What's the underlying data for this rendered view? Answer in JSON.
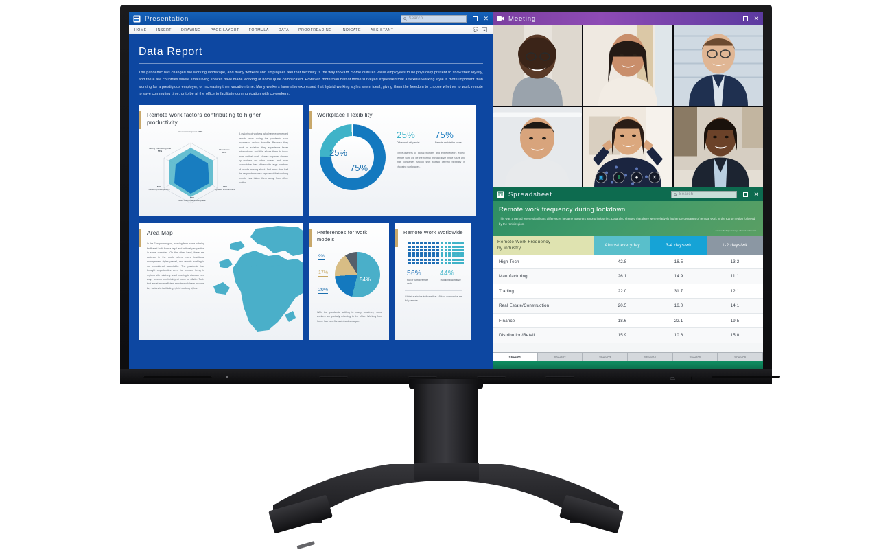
{
  "presentation": {
    "title": "Presentation",
    "icon": "presentation-icon",
    "search_placeholder": "Search",
    "ribbon_tabs": [
      "HOME",
      "INSERT",
      "DRAWING",
      "PAGE LAYOUT",
      "FORMULA",
      "DATA",
      "PROOFREADING",
      "INDICATE",
      "ASSISTANT"
    ],
    "slide_title": "Data Report",
    "slide_body": "The pandemic has changed the working landscape, and many workers and employees feel that flexibility is the way forward. Some cultures value employees to be physically present to show their loyalty, and there are countries where small living spaces have made working at home quite complicated. However, more than half of those surveyed expressed that a flexible working style is more important than working for a prestigious employer, or increasing their vacation time. Many workers have also expressed that hybrid working styles seem ideal, giving them the freedom to choose whether to work remote to save commuting time, or to be at the office to facilitate communication with co-workers.",
    "cards": {
      "radar": {
        "title": "Remote work factors contributing to higher productivity",
        "body": "A majority of workers who have experienced remote work during the pandemic have expressed various benefits. Because they work in isolation, they experience fewer interruptions, and this allows them to focus more on their work. Homes or places chosen by workers are often quieter and more comfortable than offices with large numbers of people moving about. And more than half the respondents also expressed that working remote has taken them away from office politics."
      },
      "donut": {
        "title": "Workplace Flexibility",
        "center_major": "75%",
        "center_minor": "25%",
        "stat1_value": "25%",
        "stat1_caption": "Office work will persist",
        "stat2_value": "75%",
        "stat2_caption": "Remote work is the future",
        "body": "Three-quarters of global workers and entrepreneurs expect remote work will be the normal working style in the future and that companies should shift toward offering flexibility in choosing workplaces."
      },
      "map": {
        "title": "Area Map",
        "body": "In the European region, working from home is being facilitated both from a legal and cultural perspective in some countries. On the other hand, there are cultures in the world where more traditional management styles prevail, and remote working is not considered acceptable. The pandemic has brought opportunities even for workers living in regions with relatively small housing to discover new ways to work comfortably at home or offsite. Tools that assist more efficient remote work have become key factors in facilitating hybrid working styles."
      },
      "pie": {
        "title": "Preferences for work models",
        "body": "With the pandemic settling in many countries, some workers are partially returning to the office. Working from home has benefits and disadvantages."
      },
      "picto": {
        "title": "Remote Work Worldwide",
        "stat1_value": "56%",
        "stat1_caption": "Full or partial remote work",
        "stat2_value": "44%",
        "stat2_caption": "Traditional workstyle",
        "body": "Global statistics indicate that 16% of companies are fully remote."
      }
    }
  },
  "meeting": {
    "title": "Meeting",
    "icon": "video-camera-icon",
    "controls": [
      {
        "name": "camera-toggle",
        "glyph": "▣",
        "color": "#2aa8e0"
      },
      {
        "name": "microphone-toggle",
        "glyph": "‖",
        "color": "#27b36a"
      },
      {
        "name": "raise-hand-button",
        "glyph": "●",
        "color": "#ffffff"
      },
      {
        "name": "end-call-button",
        "glyph": "✕",
        "color": "#e8eaed"
      }
    ],
    "participants": [
      "participant-1",
      "participant-2",
      "participant-3",
      "participant-4",
      "participant-5",
      "participant-6"
    ]
  },
  "spreadsheet": {
    "title": "Spreadsheet",
    "icon": "spreadsheet-icon",
    "search_placeholder": "Search",
    "hero_title": "Remote work frequency during lockdown",
    "hero_sub": "This was a period where significant differences became apparent among industries. Data also showed that there were relatively higher percentages of remote work in the Kanto region followed by the Kinki region.",
    "source": "Source: Multiple surveys shared on internet.",
    "sheet_tabs": [
      "Sheet01",
      "Sheet02",
      "Sheet03",
      "Sheet04",
      "Sheet05",
      "Sheet06"
    ],
    "active_tab": "Sheet01"
  },
  "monitor": {
    "power_icon": "power-icon",
    "indicator_icon": "indicator-icon"
  },
  "colors": {
    "presentation_blue": "#0d47a1",
    "meeting_purple": "#8e4bb5",
    "spreadsheet_green": "#0d6b4f",
    "accent_teal": "#3fb3c8",
    "accent_blue": "#1479bf",
    "accent_gold": "#c8a86b"
  },
  "chart_data": [
    {
      "type": "radar",
      "title": "Remote work factors contributing to higher productivity",
      "categories": [
        "Fewer interruptions",
        "More focus",
        "Quieter environment",
        "More comfortable workplace",
        "Avoiding office politics",
        "Saving commuting time"
      ],
      "values": [
        70,
        65,
        70,
        60,
        50,
        55
      ],
      "tick_labels": [
        "70%",
        "65%",
        "70%",
        "60%",
        "50%",
        "55%"
      ],
      "ylim": [
        0,
        100
      ],
      "grid": true,
      "legend": "none"
    },
    {
      "type": "pie",
      "subtype": "donut",
      "title": "Workplace Flexibility",
      "categories": [
        "Remote work is the future",
        "Office work will persist"
      ],
      "values": [
        75,
        25
      ],
      "labels": [
        "75%",
        "25%"
      ],
      "colors": [
        "#1479bf",
        "#3fb3c8"
      ],
      "legend": "inline"
    },
    {
      "type": "pie",
      "title": "Preferences for work models",
      "categories": [
        "54%",
        "20%",
        "17%",
        "9%"
      ],
      "values": [
        54,
        20,
        17,
        9
      ],
      "labels": [
        "54%",
        "20%",
        "17%",
        "9%"
      ],
      "colors": [
        "#4aafc9",
        "#1479bf",
        "#d8bd85",
        "#555f6a"
      ],
      "legend": "callout"
    },
    {
      "type": "pictogram",
      "title": "Remote Work Worldwide",
      "categories": [
        "Full or partial remote work",
        "Traditional workstyle"
      ],
      "values": [
        56,
        44
      ],
      "labels": [
        "56%",
        "44%"
      ],
      "colors": [
        "#1f6fb5",
        "#3fb3c8"
      ],
      "total_units": 98,
      "grid_columns": 14,
      "grid_rows": 7
    },
    {
      "type": "table",
      "title": "Remote work frequency during lockdown",
      "columns": [
        "Remote Work Frequency by industry",
        "Almost everyday",
        "3-4 days/wk",
        "1-2 days/wk"
      ],
      "rows": [
        {
          "industry": "High-Tech",
          "values": [
            "42.8",
            "16.5",
            "13.2"
          ]
        },
        {
          "industry": "Manufacturing",
          "values": [
            "26.1",
            "14.9",
            "11.1"
          ]
        },
        {
          "industry": "Trading",
          "values": [
            "22.0",
            "31.7",
            "12.1"
          ]
        },
        {
          "industry": "Real Estate/Construction",
          "values": [
            "20.5",
            "16.0",
            "14.1"
          ]
        },
        {
          "industry": "Finance",
          "values": [
            "18.6",
            "22.1",
            "19.5"
          ]
        },
        {
          "industry": "Distribution/Retail",
          "values": [
            "15.9",
            "10.6",
            "15.0"
          ]
        }
      ],
      "source": "Source: Multiple surveys shared on internet."
    }
  ]
}
